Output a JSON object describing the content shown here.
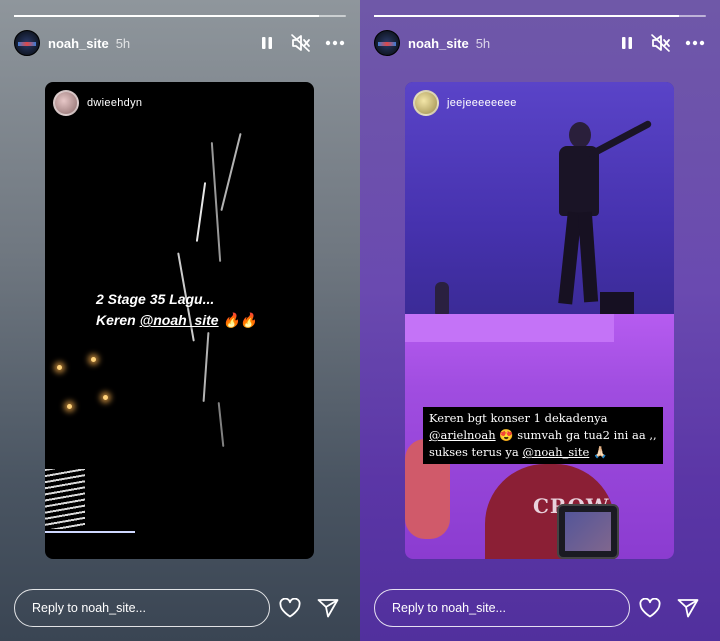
{
  "stories": [
    {
      "user": {
        "username": "noah_site",
        "time": "5h"
      },
      "post": {
        "author": "dwieehdyn",
        "caption_line1": "2 Stage 35 Lagu...",
        "caption_line2_prefix": "Keren ",
        "caption_mention": "@noah_site",
        "caption_emoji": " 🔥🔥"
      },
      "reply_placeholder": "Reply to noah_site..."
    },
    {
      "user": {
        "username": "noah_site",
        "time": "5h"
      },
      "post": {
        "author": "jeejeeeeeeee",
        "caption_line1": "Keren bgt konser 1 dekadenya",
        "caption_mention1": "@arielnoah",
        "caption_line2_rest": " 😍 sumvah ga tua2 ini aa ,,",
        "caption_line3_prefix": "sukses terus ya ",
        "caption_mention2": "@noah_site",
        "caption_emoji": " 🙏🏻",
        "shirt_text": "CROW"
      },
      "reply_placeholder": "Reply to noah_site..."
    }
  ],
  "icons": {
    "pause": "pause-icon",
    "mute": "muted-speaker-icon",
    "more": "more-horizontal-icon",
    "like": "heart-icon",
    "share": "send-icon"
  }
}
